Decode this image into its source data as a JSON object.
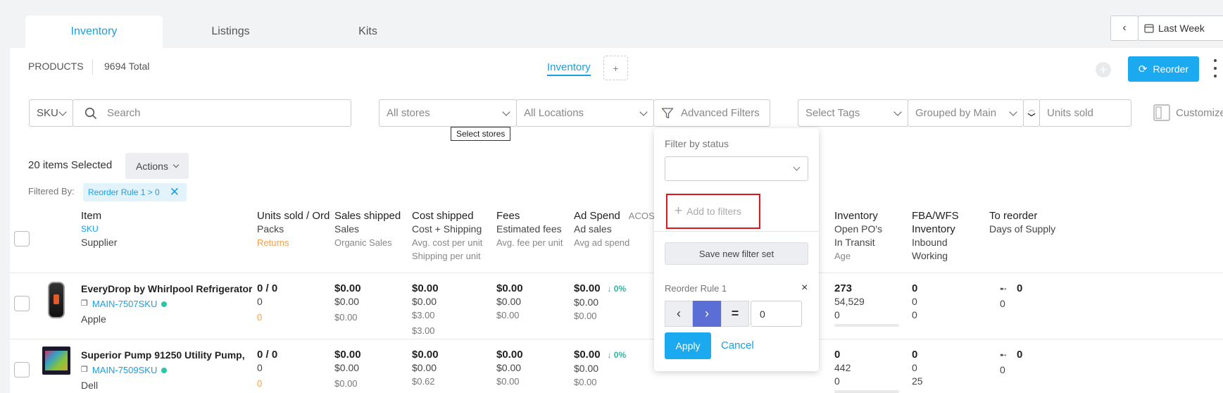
{
  "tabs": [
    "Inventory",
    "Listings",
    "Kits"
  ],
  "date_range": {
    "label": "Last Week"
  },
  "products": {
    "label": "PRODUCTS",
    "total": "9694 Total"
  },
  "view_tabs": {
    "active": "Inventory",
    "add": "+"
  },
  "reorder_button": "Reorder",
  "filters": {
    "sku": "SKU",
    "search_placeholder": "Search",
    "stores": "All stores",
    "locations": "All Locations",
    "advanced": "Advanced Filters",
    "tags": "Select Tags",
    "grouped": "Grouped by Main",
    "units": "Units sold",
    "customize": "Customize",
    "tooltip": "Select stores"
  },
  "selection": {
    "count": "20 items Selected",
    "actions": "Actions"
  },
  "filtered_by": {
    "label": "Filtered By:",
    "chip": "Reorder Rule 1 > 0"
  },
  "columns": {
    "item": {
      "l1": "Item",
      "l2": "SKU",
      "l3": "Supplier"
    },
    "units": {
      "l1": "Units sold / Ord",
      "l2": "Packs",
      "l3": "Returns"
    },
    "sales": {
      "l1": "Sales shipped",
      "l2": "Sales",
      "l3": "Organic Sales"
    },
    "cost": {
      "l1": "Cost shipped",
      "l2": "Cost + Shipping",
      "l3": "Avg. cost per unit",
      "l4": "Shipping per unit"
    },
    "fees": {
      "l1": "Fees",
      "l2": "Estimated fees",
      "l3": "Avg. fee per unit"
    },
    "ad": {
      "l1": "Ad Spend",
      "l1b": "ACOS",
      "l2": "Ad sales",
      "l3": "Avg ad spend"
    },
    "inventory": {
      "l1": "Inventory",
      "l2": "Open PO's",
      "l3": "In Transit",
      "l4": "Age"
    },
    "fba": {
      "l1": "FBA/WFS",
      "l2": "Inventory",
      "l3": "Inbound",
      "l4": "Working"
    },
    "reorder": {
      "l1": "To reorder",
      "l2": "Days of Supply"
    }
  },
  "rows": [
    {
      "name": "EveryDrop by Whirlpool Refrigerator",
      "sku": "MAIN-7507SKU",
      "supplier": "Apple",
      "units": {
        "a": "0 / 0",
        "b": "0",
        "c": "0"
      },
      "sales": {
        "a": "$0.00",
        "b": "$0.00",
        "c": "$0.00"
      },
      "cost": {
        "a": "$0.00",
        "b": "$0.00",
        "c": "$3.00",
        "d": "$3.00"
      },
      "fees": {
        "a": "$0.00",
        "b": "$0.00",
        "c": "$0.00"
      },
      "ad": {
        "a": "$0.00",
        "pct": "0%",
        "b": "$0.00",
        "c": "$0.00"
      },
      "inventory": {
        "a": "273",
        "b": "54,529",
        "c": "0"
      },
      "fba": {
        "a": "0",
        "b": "0",
        "c": "0"
      },
      "reorder": {
        "a": "0",
        "b": "0"
      }
    },
    {
      "name": "Superior Pump 91250 Utility Pump,",
      "sku": "MAIN-7509SKU",
      "supplier": "Dell",
      "units": {
        "a": "0 / 0",
        "b": "0",
        "c": "0"
      },
      "sales": {
        "a": "$0.00",
        "b": "$0.00",
        "c": "$0.00"
      },
      "cost": {
        "a": "$0.00",
        "b": "$0.00",
        "c": "$0.62"
      },
      "fees": {
        "a": "$0.00",
        "b": "$0.00",
        "c": "$0.00"
      },
      "ad": {
        "a": "$0.00",
        "pct": "0%",
        "b": "$0.00",
        "c": "$0.00"
      },
      "inventory": {
        "a": "0",
        "b": "442",
        "c": "0"
      },
      "fba": {
        "a": "0",
        "b": "0",
        "c": "25"
      },
      "reorder": {
        "a": "0",
        "b": "0"
      }
    }
  ],
  "filter_popup": {
    "status_label": "Filter by status",
    "add": "Add to filters",
    "save": "Save new filter set",
    "rule_label": "Reorder Rule 1",
    "close": "×",
    "value": "0",
    "apply": "Apply",
    "cancel": "Cancel"
  }
}
